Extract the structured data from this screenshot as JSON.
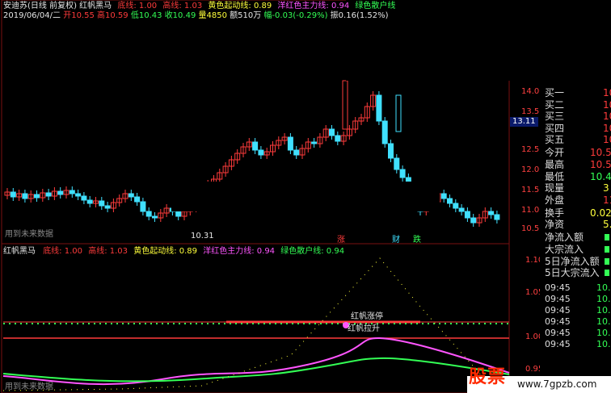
{
  "header": {
    "title": "安迪苏(日线 前复权) 红帆黑马",
    "bottom_line_label": "底线: 1.00",
    "top_line_label": "高线: 1.03",
    "yellow_label": "黄色起动线: 0.89",
    "magenta_label": "洋红色主力线: 0.94",
    "green_label": "绿色散户线",
    "date": "2019/06/04/二",
    "open": "开10.55",
    "high": "高10.59",
    "low": "低10.43",
    "close": "收10.49",
    "volume": "量4850",
    "amount": "额510万",
    "change": "幅-0.03(-0.29%)",
    "swing": "振0.16(1.52%)",
    "prefix_open_marker": "二"
  },
  "main_chart": {
    "price_marker_low": "10.31",
    "current_price_tag": "13.11",
    "footer_note": "用到未来数据",
    "markers": [
      "涨",
      "财",
      "跌"
    ],
    "y_ticks": [
      "14.00",
      "13.50",
      "13.00",
      "12.50",
      "12.00",
      "11.50",
      "11.00",
      "10.50"
    ]
  },
  "indicator": {
    "title": "红帆黑马",
    "bottom_line_label": "底线: 1.00",
    "top_line_label": "高线: 1.03",
    "yellow_label": "黄色起动线: 0.89",
    "magenta_label": "洋红色主力线: 0.94",
    "green_label": "绿色散户线: 0.94",
    "annotation_top": "红帆涨停",
    "annotation_bottom": "红帆拉升",
    "footer_note": "用到未来数据",
    "y_ticks": [
      "1.10",
      "1.05",
      "1.00",
      "0.95"
    ]
  },
  "quote_panel": {
    "rows": [
      {
        "label": "买一",
        "value": "10"
      },
      {
        "label": "买二",
        "value": "10"
      },
      {
        "label": "买三",
        "value": "10"
      },
      {
        "label": "买四",
        "value": "10"
      },
      {
        "label": "买五",
        "value": "10"
      },
      {
        "label": "今开",
        "value": "10.5"
      },
      {
        "label": "最高",
        "value": "10.5"
      },
      {
        "label": "最低",
        "value": "10.4"
      },
      {
        "label": "现量",
        "value": "3"
      },
      {
        "label": "外盘",
        "value": "110"
      },
      {
        "label": "换手",
        "value": "0.02%"
      },
      {
        "label": "净资",
        "value": "5.0"
      },
      {
        "label": "净流入额",
        "value": ""
      },
      {
        "label": "大宗流入",
        "value": ""
      },
      {
        "label": "5日净流入额",
        "value": ""
      },
      {
        "label": "5日大宗流入",
        "value": ""
      }
    ],
    "ticks": [
      {
        "time": "09:45",
        "price": "10.4"
      },
      {
        "time": "09:45",
        "price": "10.4"
      },
      {
        "time": "09:45",
        "price": "10.4"
      },
      {
        "time": "09:45",
        "price": "10.4"
      },
      {
        "time": "09:45",
        "price": "10.4"
      },
      {
        "time": "09:45",
        "price": "10.4"
      }
    ]
  },
  "watermark": {
    "logo_text": "股票",
    "url": "www.7gpzb.com"
  },
  "colors": {
    "up": "#ff3b3b",
    "down": "#40e0ff",
    "yellow": "#ffff3b",
    "magenta": "#ff55ff",
    "green": "#33ff55"
  }
}
